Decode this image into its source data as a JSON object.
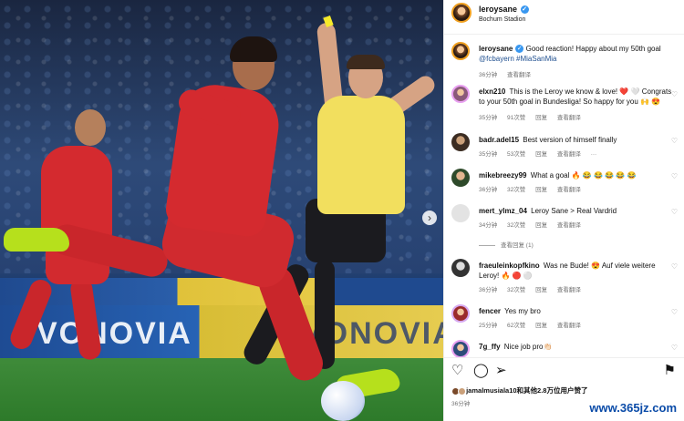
{
  "post": {
    "username": "leroysane",
    "location": "Bochum Stadion"
  },
  "caption": {
    "username": "leroysane",
    "text": "Good reaction! Happy about my 50th goal",
    "tags": "@fcbayern #MiaSanMia",
    "time": "36分钟",
    "translate": "查看翻译"
  },
  "comments": [
    {
      "username": "elxn210",
      "text": "This is the Leroy we know & love! ❤️ 🤍 Congrats to your 50th goal in Bundesliga! So happy for you 🙌 😍",
      "time": "35分钟",
      "likes": "91次赞",
      "reply": "回复",
      "translate": "查看翻译"
    },
    {
      "username": "badr.adel15",
      "text": "Best version of himself finally",
      "time": "35分钟",
      "likes": "53次赞",
      "reply": "回复",
      "translate": "查看翻译",
      "more": "···"
    },
    {
      "username": "mikebreezy99",
      "text": "What a goal 🔥 😂 😂 😂 😂 😂",
      "time": "36分钟",
      "likes": "32次赞",
      "reply": "回复",
      "translate": "查看翻译"
    },
    {
      "username": "mert_ylmz_04",
      "text": "Leroy Sane > Real Vardrid",
      "time": "34分钟",
      "likes": "32次赞",
      "reply": "回复",
      "translate": "查看翻译",
      "replies": "查看回复 (1)"
    },
    {
      "username": "fraeuleinkopfkino",
      "text": "Was ne Bude! 😍 Auf viele weitere Leroy! 🔥 🔴 ⚪",
      "time": "36分钟",
      "likes": "32次赞",
      "reply": "回复",
      "translate": "查看翻译"
    },
    {
      "username": "fencer",
      "text": "Yes my bro",
      "time": "25分钟",
      "likes": "62次赞",
      "reply": "回复",
      "translate": "查看翻译"
    },
    {
      "username": "7g_ffy",
      "text": "Nice job pro👏🏻"
    }
  ],
  "likes": {
    "text": "jamalmusiala10和其他2.8万位用户赞了",
    "time": "36分钟"
  },
  "photo": {
    "ad_left": "VONOVIA",
    "ad_right": "VONOVIA"
  },
  "watermark": "www.365jz.com",
  "colors": {
    "accent_blue": "#3897f0",
    "jersey_red": "#d42a2f",
    "ref_yellow": "#f2df5e"
  }
}
